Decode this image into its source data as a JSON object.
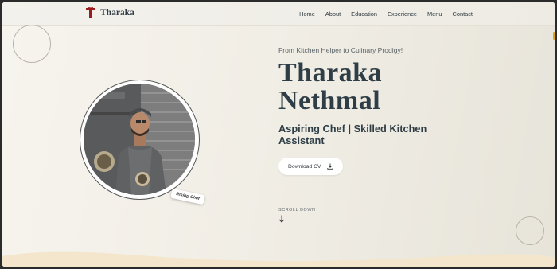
{
  "brand": {
    "name": "Tharaka"
  },
  "nav": {
    "items": [
      "Home",
      "About",
      "Education",
      "Experience",
      "Menu",
      "Contact"
    ]
  },
  "hero": {
    "eyebrow": "From Kitchen Helper to Culinary Prodigy!",
    "name_line1": "Tharaka",
    "name_line2": "Nethmal",
    "tagline": "Aspiring Chef | Skilled Kitchen Assistant",
    "cv_button": "Download CV",
    "scroll_label": "SCROLL DOWN",
    "badge": "Rising Chef"
  },
  "colors": {
    "primary": "#2f3e46",
    "logo_red": "#9b1c1c",
    "accent": "#e0a21a",
    "wave": "#f3e6cc"
  },
  "icons": {
    "logo": "chef-t-logo",
    "download": "download-icon",
    "scroll": "arrow-down-icon"
  }
}
